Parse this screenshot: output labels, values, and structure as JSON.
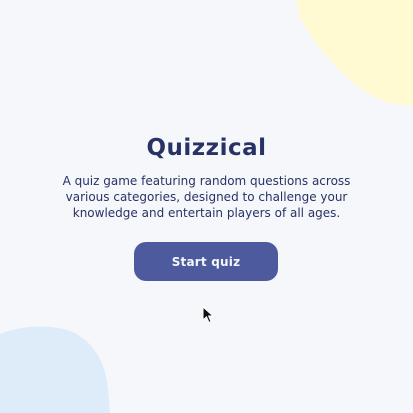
{
  "colors": {
    "background": "#F5F7FB",
    "title": "#293264",
    "button_bg": "#4D5B9E",
    "button_text": "#F5F7FB",
    "blob_yellow": "#FFFAD1",
    "blob_blue": "#DEEBF8"
  },
  "intro": {
    "title": "Quizzical",
    "description": "A quiz game featuring random questions across various categories, designed to challenge your knowledge and entertain players of all ages.",
    "start_label": "Start quiz"
  },
  "icons": {
    "cursor": "arrow-cursor-icon"
  }
}
